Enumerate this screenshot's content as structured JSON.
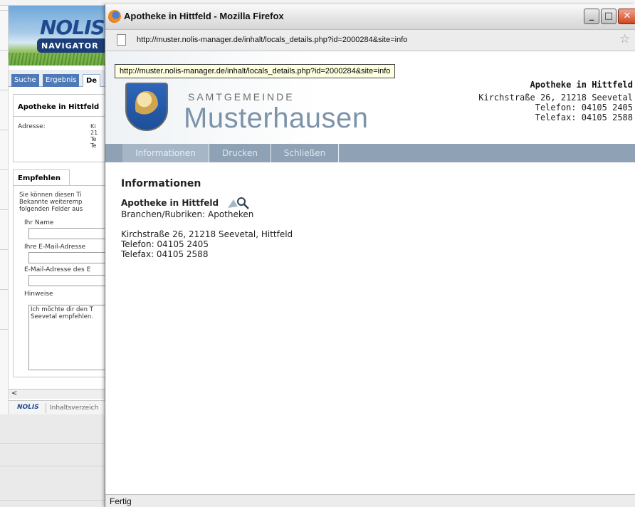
{
  "background": {
    "logo_text": "NOLIS",
    "logo_sub": "NAVIGATOR",
    "tabs": [
      {
        "label": "Suche"
      },
      {
        "label": "Ergebnis"
      },
      {
        "label": "De"
      }
    ],
    "card_title": "Apotheke in Hittfeld",
    "address_label": "Adresse:",
    "address_values": "Ki\n21\nTe\nTe",
    "recommend_tab": "Empfehlen",
    "recommend_text": "Sie können diesen Ti\nBekannte weiteremp\nfolgenden Felder aus",
    "fields": [
      {
        "label": "Ihr Name"
      },
      {
        "label": "Ihre E-Mail-Adresse"
      },
      {
        "label": "E-Mail-Adresse des E"
      }
    ],
    "notes_label": "Hinweise",
    "notes_text": "Ich möchte dir den T\nSeevetal empfehlen.",
    "footer_logo": "NOLIS",
    "footer_link": "Inhaltsverzeich"
  },
  "browser": {
    "title": "Apotheke in Hittfeld - Mozilla Firefox",
    "url": "http://muster.nolis-manager.de/inhalt/locals_details.php?id=2000284&site=info",
    "tooltip": "http://muster.nolis-manager.de/inhalt/locals_details.php?id=2000284&site=info",
    "status": "Fertig",
    "window_buttons": [
      "minimize",
      "maximize",
      "close"
    ]
  },
  "page": {
    "brand_top": "SAMTGEMEINDE",
    "brand_main": "Musterhausen",
    "contact": {
      "name": "Apotheke in Hittfeld",
      "address": "Kirchstraße 26, 21218 Seevetal",
      "phone": "Telefon: 04105 2405",
      "fax": "Telefax: 04105 2588"
    },
    "nav": [
      {
        "label": "Informationen"
      },
      {
        "label": "Drucken"
      },
      {
        "label": "Schließen"
      }
    ],
    "section_heading": "Informationen",
    "entry_name": "Apotheke in Hittfeld",
    "category": "Branchen/Rubriken: Apotheken",
    "address": "Kirchstraße 26, 21218 Seevetal, Hittfeld",
    "phone": "Telefon: 04105 2405",
    "fax": "Telefax: 04105 2588"
  },
  "colors": {
    "nav_bar": "#8ea1b5",
    "nav_active": "#a6b6c7",
    "brand_text": "#7d93a9",
    "tooltip_bg": "#ffffe1"
  }
}
